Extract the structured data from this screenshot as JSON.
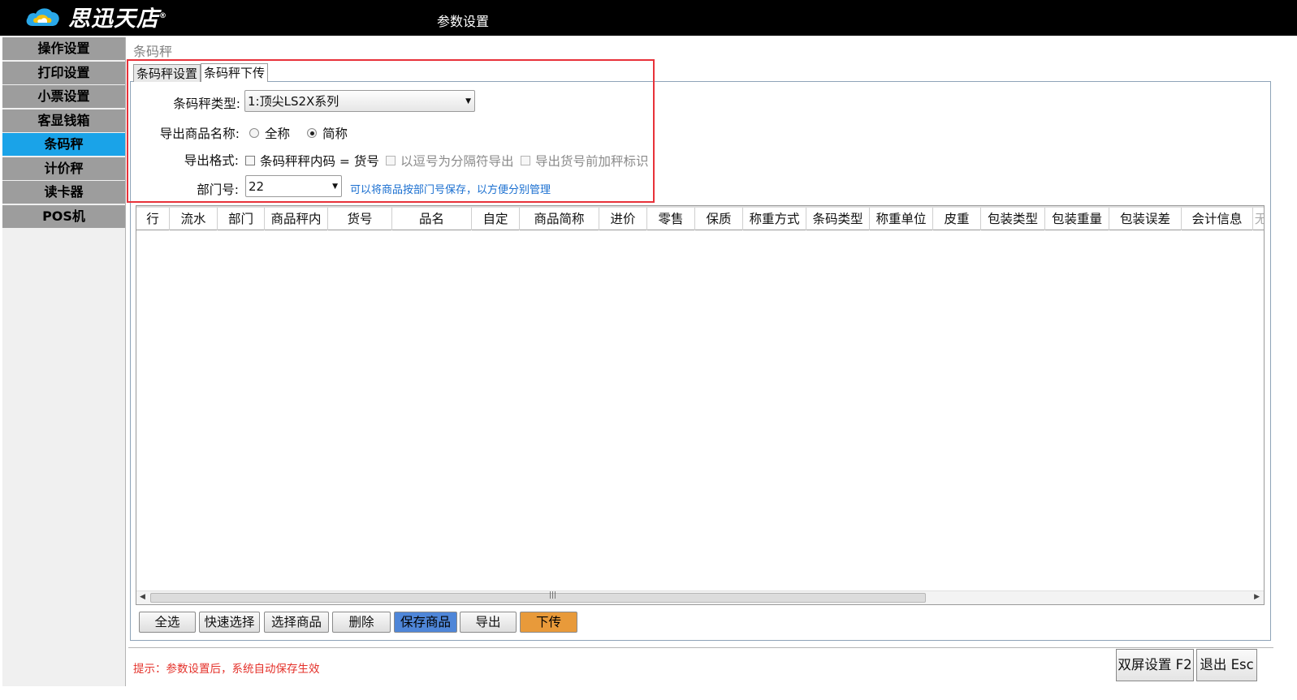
{
  "window": {
    "title": "参数设置",
    "brand": "思迅天店",
    "brand_mark": "®"
  },
  "sidebar": {
    "items": [
      {
        "label": "操作设置",
        "active": false
      },
      {
        "label": "打印设置",
        "active": false
      },
      {
        "label": "小票设置",
        "active": false
      },
      {
        "label": "客显钱箱",
        "active": false
      },
      {
        "label": "条码秤",
        "active": true
      },
      {
        "label": "计价秤",
        "active": false
      },
      {
        "label": "读卡器",
        "active": false
      },
      {
        "label": "POS机",
        "active": false
      }
    ],
    "active_color": "#1aa3e8"
  },
  "section_title": "条码秤",
  "tabs": [
    {
      "label": "条码秤设置",
      "active": false
    },
    {
      "label": "条码秤下传",
      "active": true
    }
  ],
  "form": {
    "scale_type": {
      "label": "条码秤类型:",
      "value": "1:顶尖LS2X系列"
    },
    "export_name": {
      "label": "导出商品名称:",
      "options": [
        "全称",
        "简称"
      ],
      "selected": "简称"
    },
    "export_format": {
      "label": "导出格式:",
      "options": [
        {
          "label": "条码秤秤内码 = 货号",
          "checked": false,
          "enabled": true
        },
        {
          "label": "以逗号为分隔符导出",
          "checked": false,
          "enabled": false
        },
        {
          "label": "导出货号前加秤标识",
          "checked": false,
          "enabled": false
        }
      ]
    },
    "department": {
      "label": "部门号:",
      "value": "22",
      "hint": "可以将商品按部门号保存，以方便分别管理"
    }
  },
  "grid": {
    "columns": [
      "行",
      "流水",
      "部门",
      "商品秤内",
      "货号",
      "品名",
      "自定",
      "商品简称",
      "进价",
      "零售",
      "保质",
      "称重方式",
      "条码类型",
      "称重单位",
      "皮重",
      "包装类型",
      "包装重量",
      "包装误差",
      "会计信息",
      "无"
    ],
    "rows": []
  },
  "buttons": {
    "select_all": "全选",
    "quick_select": "快速选择",
    "select_goods": "选择商品",
    "delete": "删除",
    "save_goods": "保存商品",
    "export": "导出",
    "download": "下传"
  },
  "footer": {
    "hint": "提示：参数设置后，系统自动保存生效",
    "dual_screen": "双屏设置 F2",
    "exit": "退出 Esc"
  },
  "colors": {
    "highlight_border": "#e8323a",
    "save_button": "#4f86d8",
    "download_button": "#e89a3a",
    "hint_text": "#e4312a"
  }
}
